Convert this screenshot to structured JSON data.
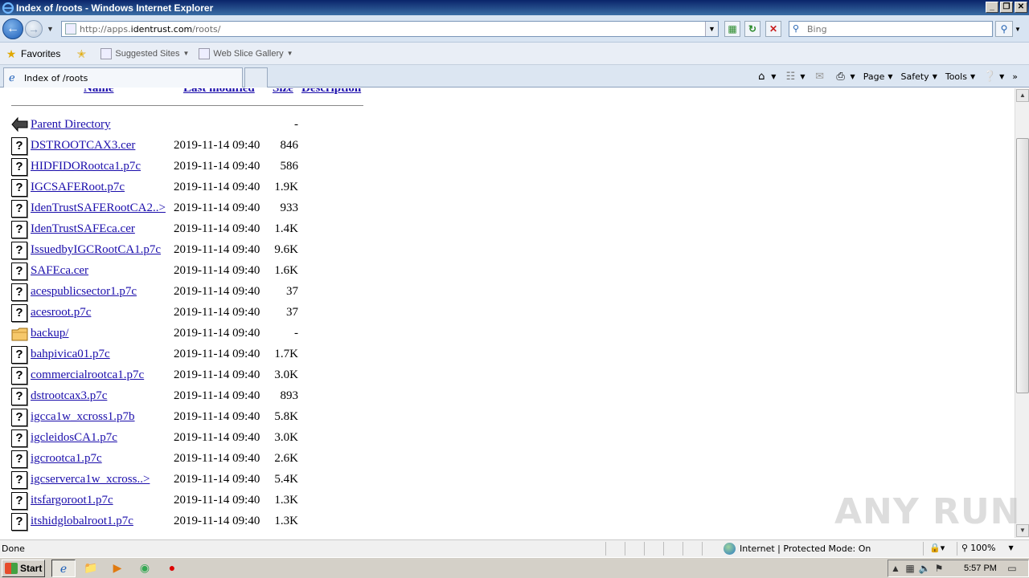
{
  "window": {
    "title": "Index of /roots - Windows Internet Explorer",
    "controls": [
      "_",
      "❐",
      "✕"
    ]
  },
  "address": {
    "url_prefix": "http://apps.",
    "url_domain": "identrust.com",
    "url_path": "/roots/",
    "search_placeholder": "Bing"
  },
  "favorites_bar": {
    "favorites_label": "Favorites",
    "suggested_sites": "Suggested Sites",
    "web_slice_gallery": "Web Slice Gallery"
  },
  "tab": {
    "title": "Index of /roots"
  },
  "command_bar": {
    "page": "Page",
    "safety": "Safety",
    "tools": "Tools"
  },
  "listing": {
    "headers": {
      "name": "Name",
      "modified": "Last modified",
      "size": "Size",
      "description": "Description"
    },
    "rows": [
      {
        "name": "Parent Directory",
        "date": "",
        "size": "-",
        "icon": "back"
      },
      {
        "name": "DSTROOTCAX3.cer",
        "date": "2019-11-14 09:40",
        "size": "846",
        "icon": "unknown"
      },
      {
        "name": "HIDFIDORootca1.p7c",
        "date": "2019-11-14 09:40",
        "size": "586",
        "icon": "unknown"
      },
      {
        "name": "IGCSAFERoot.p7c",
        "date": "2019-11-14 09:40",
        "size": "1.9K",
        "icon": "unknown"
      },
      {
        "name": "IdenTrustSAFERootCA2..>",
        "date": "2019-11-14 09:40",
        "size": "933",
        "icon": "unknown"
      },
      {
        "name": "IdenTrustSAFEca.cer",
        "date": "2019-11-14 09:40",
        "size": "1.4K",
        "icon": "unknown"
      },
      {
        "name": "IssuedbyIGCRootCA1.p7c",
        "date": "2019-11-14 09:40",
        "size": "9.6K",
        "icon": "unknown"
      },
      {
        "name": "SAFEca.cer",
        "date": "2019-11-14 09:40",
        "size": "1.6K",
        "icon": "unknown"
      },
      {
        "name": "acespublicsector1.p7c",
        "date": "2019-11-14 09:40",
        "size": "37",
        "icon": "unknown"
      },
      {
        "name": "acesroot.p7c",
        "date": "2019-11-14 09:40",
        "size": "37",
        "icon": "unknown"
      },
      {
        "name": "backup/",
        "date": "2019-11-14 09:40",
        "size": "-",
        "icon": "folder"
      },
      {
        "name": "bahpivica01.p7c",
        "date": "2019-11-14 09:40",
        "size": "1.7K",
        "icon": "unknown"
      },
      {
        "name": "commercialrootca1.p7c",
        "date": "2019-11-14 09:40",
        "size": "3.0K",
        "icon": "unknown"
      },
      {
        "name": "dstrootcax3.p7c",
        "date": "2019-11-14 09:40",
        "size": "893",
        "icon": "unknown"
      },
      {
        "name": "igcca1w_xcross1.p7b",
        "date": "2019-11-14 09:40",
        "size": "5.8K",
        "icon": "unknown"
      },
      {
        "name": "igcleidosCA1.p7c",
        "date": "2019-11-14 09:40",
        "size": "3.0K",
        "icon": "unknown"
      },
      {
        "name": "igcrootca1.p7c",
        "date": "2019-11-14 09:40",
        "size": "2.6K",
        "icon": "unknown"
      },
      {
        "name": "igcserverca1w_xcross..>",
        "date": "2019-11-14 09:40",
        "size": "5.4K",
        "icon": "unknown"
      },
      {
        "name": "itsfargoroot1.p7c",
        "date": "2019-11-14 09:40",
        "size": "1.3K",
        "icon": "unknown"
      },
      {
        "name": "itshidglobalroot1.p7c",
        "date": "2019-11-14 09:40",
        "size": "1.3K",
        "icon": "unknown"
      }
    ]
  },
  "status": {
    "text": "Done",
    "zone": "Internet | Protected Mode: On",
    "zoom": "100%"
  },
  "taskbar": {
    "start_label": "Start",
    "clock": "5:57 PM"
  },
  "watermark": "ANY RUN"
}
